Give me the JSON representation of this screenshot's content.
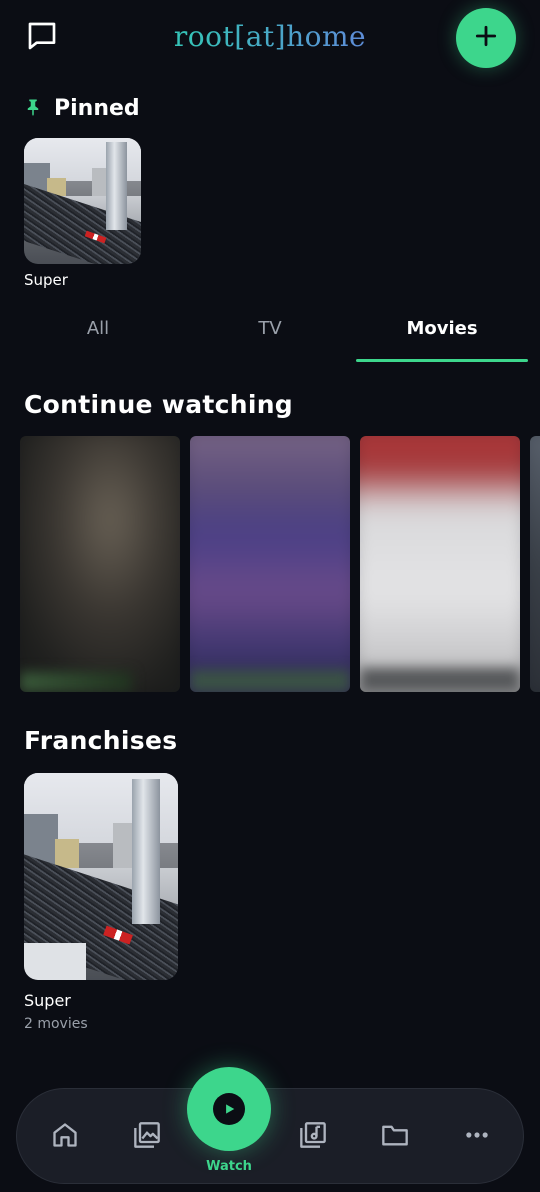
{
  "header": {
    "logo_text": "root[at]home",
    "chat_icon": "chat-bubble-icon",
    "add_icon": "plus-icon"
  },
  "pinned": {
    "title": "Pinned",
    "icon": "pin-icon",
    "items": [
      {
        "label": "Super"
      }
    ]
  },
  "tabs": [
    {
      "label": "All",
      "active": false
    },
    {
      "label": "TV",
      "active": false
    },
    {
      "label": "Movies",
      "active": true
    }
  ],
  "continue_watching": {
    "title": "Continue watching",
    "items_count_visible": 4
  },
  "franchises": {
    "title": "Franchises",
    "items": [
      {
        "name": "Super",
        "count": "2 movies"
      }
    ]
  },
  "bottom_nav": {
    "items": [
      {
        "icon": "home-icon"
      },
      {
        "icon": "photos-icon"
      },
      {
        "icon": "play-icon",
        "label": "Watch",
        "active": true
      },
      {
        "icon": "music-library-icon"
      },
      {
        "icon": "folder-icon"
      },
      {
        "icon": "more-icon"
      }
    ]
  },
  "colors": {
    "background": "#0b0d14",
    "accent": "#3dd68c",
    "muted_text": "#9aa0aa",
    "nav_background": "#1b1e27"
  }
}
